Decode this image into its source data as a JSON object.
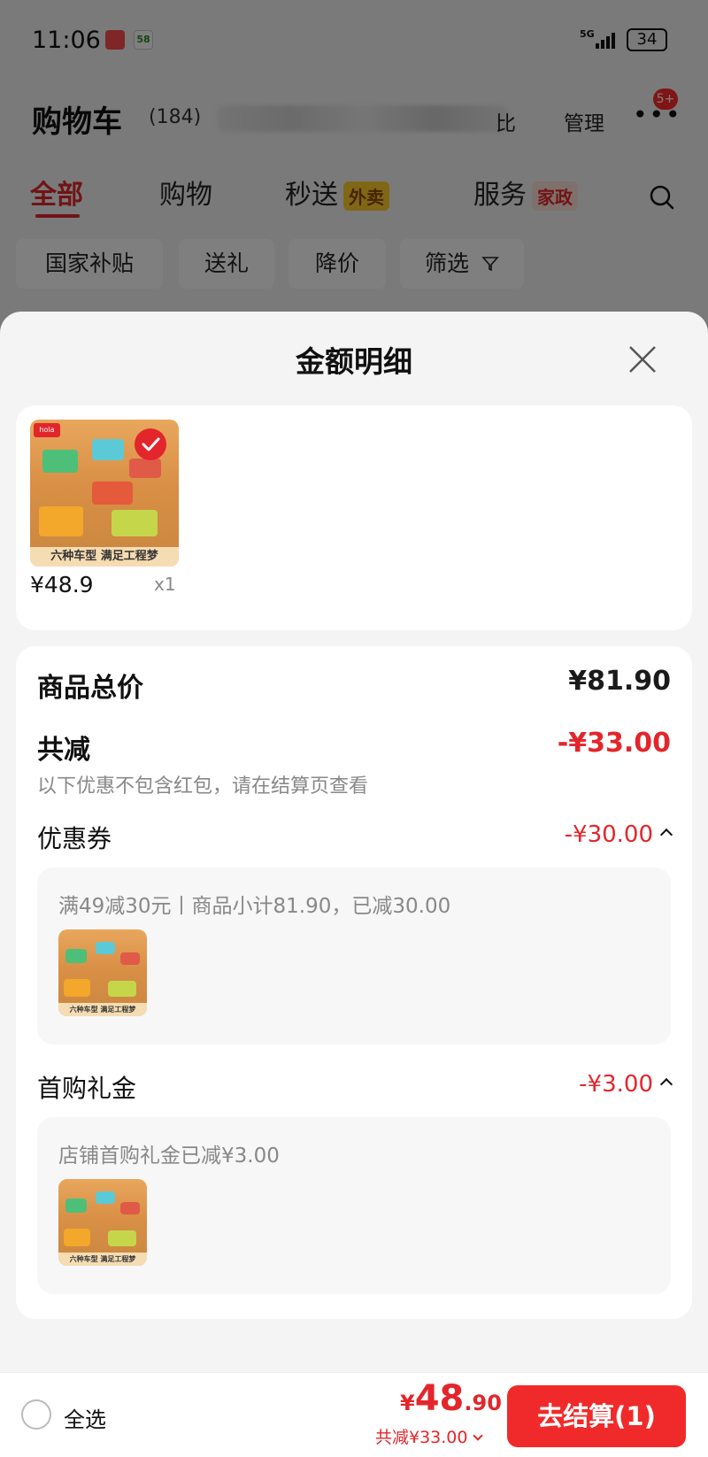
{
  "status_bar": {
    "time": "11:06",
    "network": "5G",
    "battery": "34",
    "app2_label": "58"
  },
  "header": {
    "title": "购物车",
    "count": "(184)",
    "compare": "比",
    "manage": "管理",
    "more_badge": "5+"
  },
  "tabs": [
    {
      "label": "全部",
      "active": true
    },
    {
      "label": "购物"
    },
    {
      "label": "秒送",
      "tag": "外卖"
    },
    {
      "label": "服务",
      "tag": "家政"
    }
  ],
  "filters": [
    "国家补贴",
    "送礼",
    "降价",
    "筛选"
  ],
  "sheet": {
    "title": "金额明细",
    "product": {
      "price": "¥48.9",
      "qty": "x1",
      "caption": "六种车型 满足工程梦"
    },
    "summary": {
      "total_label": "商品总价",
      "total_value": "¥81.90",
      "discount_label": "共减",
      "discount_value": "-¥33.00",
      "discount_note": "以下优惠不包含红包，请在结算页查看"
    },
    "coupon": {
      "label": "优惠券",
      "value": "-¥30.00",
      "detail": "满49减30元丨商品小计81.90，已减30.00",
      "caption": "六种车型 满足工程梦"
    },
    "gift": {
      "label": "首购礼金",
      "value": "-¥3.00",
      "detail": "店铺首购礼金已减¥3.00",
      "caption": "六种车型 满足工程梦"
    }
  },
  "bottom_bar": {
    "select_all": "全选",
    "currency": "¥",
    "price_int": "48",
    "price_dec": ".90",
    "discount": "共减¥33.00",
    "checkout": "去结算(1)"
  },
  "colors": {
    "accent": "#e3262b",
    "checkout": "#f02a2a"
  }
}
